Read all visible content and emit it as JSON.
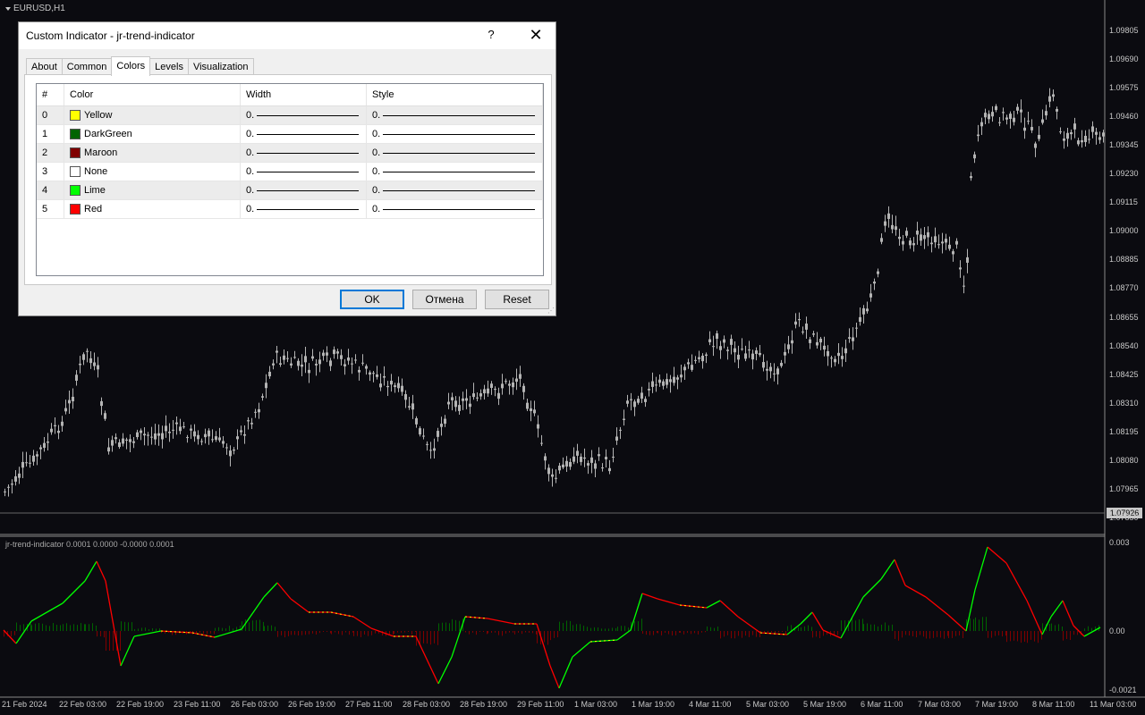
{
  "chart": {
    "symbol": "EURUSD,H1",
    "current_price": "1.07926",
    "price_axis": [
      "1.09805",
      "1.09690",
      "1.09575",
      "1.09460",
      "1.09345",
      "1.09230",
      "1.09115",
      "1.09000",
      "1.08885",
      "1.08770",
      "1.08655",
      "1.08540",
      "1.08425",
      "1.08310",
      "1.08195",
      "1.08080",
      "1.07965",
      "1.07850"
    ],
    "time_axis": [
      "21 Feb 2024",
      "22 Feb 03:00",
      "22 Feb 19:00",
      "23 Feb 11:00",
      "26 Feb 03:00",
      "26 Feb 19:00",
      "27 Feb 11:00",
      "28 Feb 03:00",
      "28 Feb 19:00",
      "29 Feb 11:00",
      "1 Mar 03:00",
      "1 Mar 19:00",
      "4 Mar 11:00",
      "5 Mar 03:00",
      "5 Mar 19:00",
      "6 Mar 11:00",
      "7 Mar 03:00",
      "7 Mar 19:00",
      "8 Mar 11:00",
      "11 Mar 03:00"
    ],
    "colors": {
      "background": "#0b0b10",
      "candle": "#b4b4b4",
      "up_line": "#00ff00",
      "down_line": "#ff0000",
      "yellow_line": "#ffff00",
      "hist_up": "#006400",
      "hist_down": "#800000"
    }
  },
  "indicator": {
    "label": "jr-trend-indicator 0.0001 0.0000 -0.0000 0.0001",
    "axis": [
      "0.003",
      "0.00",
      "-0.0021"
    ]
  },
  "dialog": {
    "title": "Custom Indicator - jr-trend-indicator",
    "help": "?",
    "close": "✕",
    "tabs": [
      "About",
      "Common",
      "Colors",
      "Levels",
      "Visualization"
    ],
    "active_tab": "Colors",
    "headers": [
      "#",
      "Color",
      "Width",
      "Style"
    ],
    "rows": [
      {
        "index": "0",
        "color_name": "Yellow",
        "hex": "#ffff00",
        "width": "0.",
        "style": "0."
      },
      {
        "index": "1",
        "color_name": "DarkGreen",
        "hex": "#006400",
        "width": "0.",
        "style": "0."
      },
      {
        "index": "2",
        "color_name": "Maroon",
        "hex": "#800000",
        "width": "0.",
        "style": "0."
      },
      {
        "index": "3",
        "color_name": "None",
        "hex": "#ffffff",
        "width": "0.",
        "style": "0."
      },
      {
        "index": "4",
        "color_name": "Lime",
        "hex": "#00ff00",
        "width": "0.",
        "style": "0."
      },
      {
        "index": "5",
        "color_name": "Red",
        "hex": "#ff0000",
        "width": "0.",
        "style": "0."
      }
    ],
    "buttons": {
      "ok": "OK",
      "cancel": "Отмена",
      "reset": "Reset"
    }
  }
}
